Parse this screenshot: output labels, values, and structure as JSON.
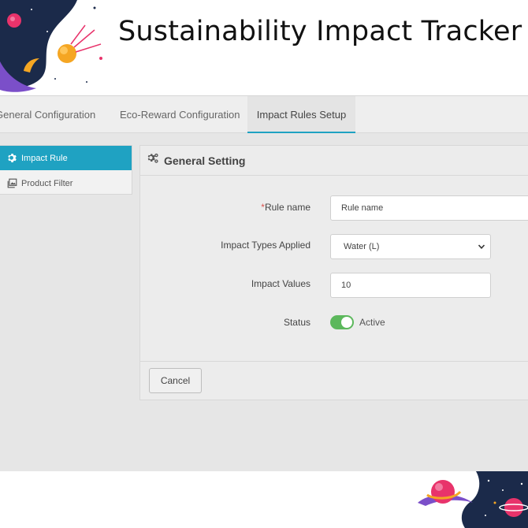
{
  "header": {
    "title": "Sustainability Impact Tracker"
  },
  "tabs": [
    {
      "label": "General Configuration",
      "active": false
    },
    {
      "label": "Eco-Reward Configuration",
      "active": false
    },
    {
      "label": "Impact Rules Setup",
      "active": true
    }
  ],
  "side_menu": {
    "items": [
      {
        "label": "Impact Rule",
        "icon": "gear-icon",
        "active": true
      },
      {
        "label": "Product Filter",
        "icon": "gallery-icon",
        "active": false
      }
    ]
  },
  "panel": {
    "title": "General Setting",
    "title_icon": "gears-icon",
    "fields": {
      "rule_name": {
        "label": "Rule name",
        "required_mark": "*",
        "value": "",
        "placeholder": "Rule name"
      },
      "impact_types": {
        "label": "Impact Types Applied",
        "selected": "Water (L)"
      },
      "impact_values": {
        "label": "Impact Values",
        "value": "10"
      },
      "status": {
        "label": "Status",
        "value": "Active",
        "enabled": true
      }
    },
    "footer": {
      "cancel_label": "Cancel"
    }
  },
  "colors": {
    "accent": "#1fa2c2",
    "toggle_on": "#5cb85c",
    "required": "#d9534f",
    "deco_dark": "#1b2a4a",
    "deco_pink": "#e8336b",
    "deco_orange": "#f5a623",
    "deco_purple": "#7b4fc9"
  }
}
